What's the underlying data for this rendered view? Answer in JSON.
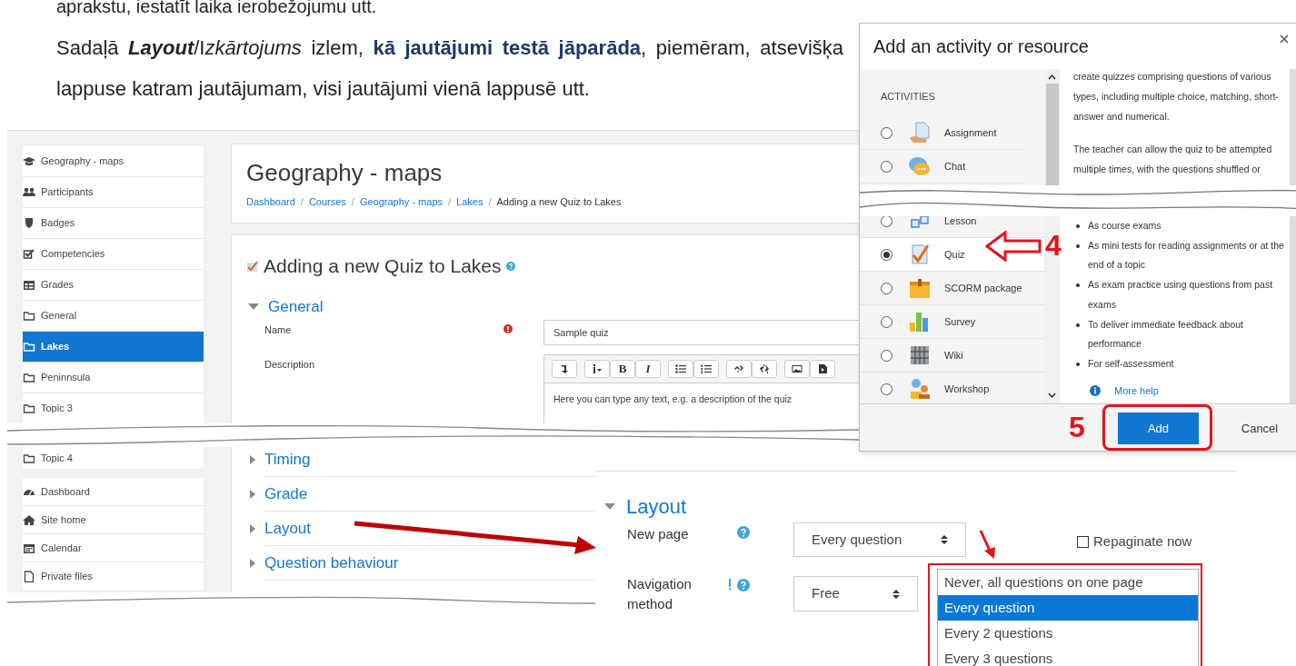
{
  "document": {
    "cut_line": "aprakstu, iestatīt laika ierobežojumu utt.",
    "paragraph": [
      {
        "kind": "plain",
        "text": "Sadaļā "
      },
      {
        "kind": "bold_italic",
        "text": "Layout"
      },
      {
        "kind": "plain",
        "text": "/I"
      },
      {
        "kind": "italic",
        "text": "zkārtojums"
      },
      {
        "kind": "plain",
        "text": " izlem, "
      },
      {
        "kind": "emphasis",
        "text": "kā jautājumi testā jāparāda"
      },
      {
        "kind": "plain",
        "text": ", piemēram, atsevišķa lappuse katram jautājumam, visi jautājumi vienā lappusē utt."
      }
    ]
  },
  "course_page": {
    "sidebar_top": [
      {
        "kind": "cap",
        "label": "Geography - maps",
        "selected": false
      },
      {
        "kind": "users",
        "label": "Participants",
        "selected": false
      },
      {
        "kind": "shield",
        "label": "Badges",
        "selected": false
      },
      {
        "kind": "check",
        "label": "Competencies",
        "selected": false
      },
      {
        "kind": "table",
        "label": "Grades",
        "selected": false
      },
      {
        "kind": "folder",
        "label": "General",
        "selected": false
      },
      {
        "kind": "folder",
        "label": "Lakes",
        "selected": true
      },
      {
        "kind": "folder",
        "label": "Peninnsula",
        "selected": false
      },
      {
        "kind": "folder",
        "label": "Topic 3",
        "selected": false
      }
    ],
    "sidebar_after_fold": [
      {
        "kind": "folder",
        "label": "Topic 4",
        "selected": false
      }
    ],
    "sidebar_bottom": [
      {
        "kind": "dashboard",
        "label": "Dashboard",
        "selected": false
      },
      {
        "kind": "home",
        "label": "Site home",
        "selected": false
      },
      {
        "kind": "calendar",
        "label": "Calendar",
        "selected": false
      },
      {
        "kind": "file",
        "label": "Private files",
        "selected": false
      }
    ],
    "title": "Geography - maps",
    "breadcrumbs": [
      {
        "text": "Dashboard",
        "link": true
      },
      {
        "separator": "/",
        "text": "Courses",
        "link": true
      },
      {
        "separator": "/",
        "text": "Geography - maps",
        "link": true
      },
      {
        "separator": "/",
        "text": "Lakes",
        "link": true
      },
      {
        "separator": "/",
        "text": "Adding a new Quiz to Lakes",
        "link": false
      }
    ],
    "form_title": "Adding a new Quiz to Lakes",
    "general": {
      "title": "General",
      "expanded": true,
      "name_label": "Name",
      "name_value": "Sample quiz",
      "description_label": "Description",
      "toolbar_letters": [
        "B",
        "I"
      ],
      "description_value": "Here you can type any text, e.g. a description of the quiz"
    },
    "collapsed_sections": [
      {
        "title": "Timing",
        "expanded": false
      },
      {
        "title": "Grade",
        "expanded": false
      },
      {
        "title": "Layout",
        "expanded": false
      },
      {
        "title": "Question behaviour",
        "expanded": false
      }
    ]
  },
  "layout_panel": {
    "title": "Layout",
    "expanded": true,
    "new_page_label": "New page",
    "new_page_value": "Every question",
    "repaginate": {
      "label": "Repaginate now",
      "checked": false
    },
    "navigation_label": "Navigation method",
    "navigation_value": "Free",
    "options": [
      {
        "text": "Never, all questions on one page",
        "selected": false
      },
      {
        "text": "Every question",
        "selected": true
      },
      {
        "text": "Every 2 questions",
        "selected": false
      },
      {
        "text": "Every 3 questions",
        "selected": false
      }
    ]
  },
  "dialog": {
    "title": "Add an activity or resource",
    "section": "ACTIVITIES",
    "before_fold": {
      "activities": [
        {
          "kind": "assignment",
          "label": "Assignment",
          "selected": false
        },
        {
          "kind": "chat",
          "label": "Chat",
          "selected": false
        }
      ],
      "paragraphs": [
        "create quizzes comprising questions of various types, including multiple choice, matching, short-answer and numerical.",
        "The teacher can allow the quiz to be attempted multiple times, with the questions shuffled or"
      ]
    },
    "after_fold": {
      "activities": [
        {
          "kind": "lesson",
          "label": "Lesson",
          "selected": false
        },
        {
          "kind": "quiz",
          "label": "Quiz",
          "selected": true
        },
        {
          "kind": "scorm",
          "label": "SCORM package",
          "selected": false
        },
        {
          "kind": "survey",
          "label": "Survey",
          "selected": false
        },
        {
          "kind": "wiki",
          "label": "Wiki",
          "selected": false
        },
        {
          "kind": "workshop",
          "label": "Workshop",
          "selected": false
        }
      ],
      "bullets": [
        "As course exams",
        "As mini tests for reading assignments or at the end of a topic",
        "As exam practice using questions from past exams",
        "To deliver immediate feedback about performance",
        "For self-assessment"
      ],
      "help_link": "More help"
    },
    "add_button": "Add",
    "cancel_button": "Cancel"
  },
  "callouts": [
    "4",
    "5"
  ]
}
